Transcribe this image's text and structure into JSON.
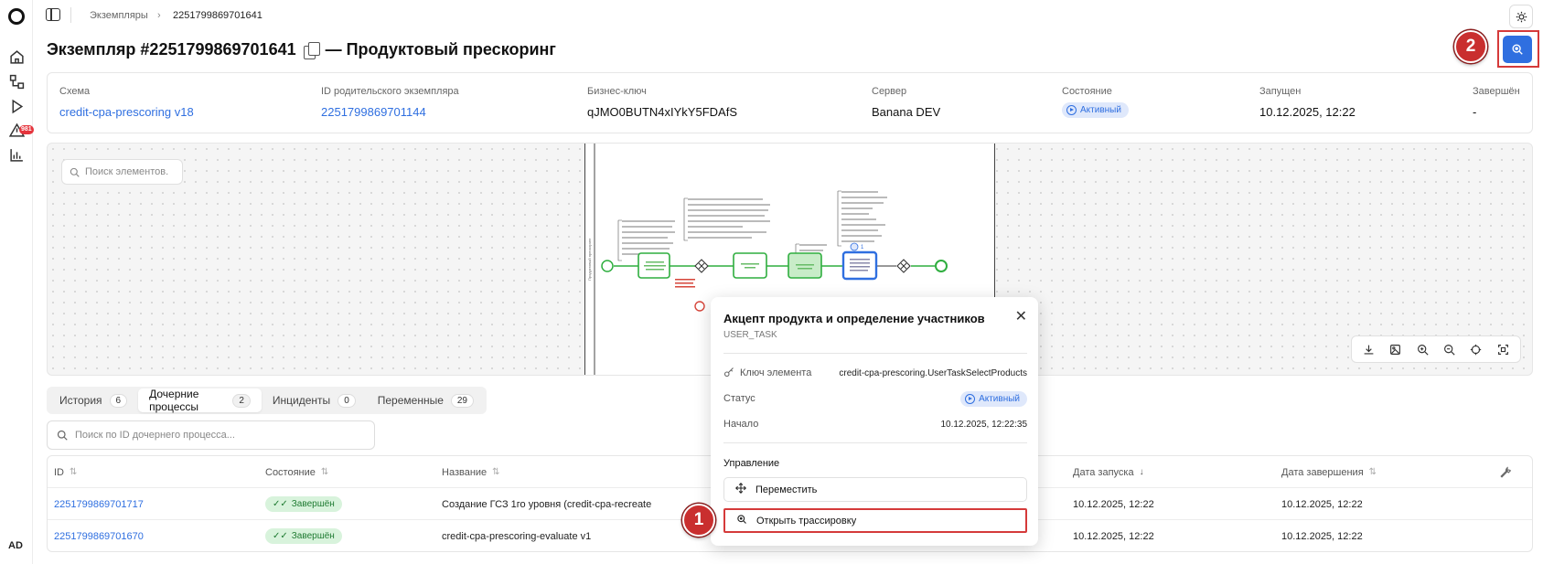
{
  "breadcrumb": {
    "parent": "Экземпляры",
    "current": "2251799869701641"
  },
  "header": {
    "title": "Экземпляр #2251799869701641",
    "subtitle": "— Продуктовый прескоринг"
  },
  "sidebar": {
    "alerts_badge": "981",
    "avatar": "AD"
  },
  "steps": {
    "one": "1",
    "two": "2"
  },
  "info": {
    "schema": {
      "label": "Схема",
      "value": "credit-cpa-prescoring v18"
    },
    "parent_id": {
      "label": "ID родительского экземпляра",
      "value": "2251799869701144"
    },
    "business_key": {
      "label": "Бизнес-ключ",
      "value": "qJMO0BUTN4xIYkY5FDAfS"
    },
    "server": {
      "label": "Сервер",
      "value": "Banana DEV"
    },
    "state": {
      "label": "Состояние",
      "value": "Активный"
    },
    "started": {
      "label": "Запущен",
      "value": "10.12.2025, 12:22"
    },
    "finished": {
      "label": "Завершён",
      "value": "-"
    }
  },
  "diagram": {
    "search_placeholder": "Поиск элементов.",
    "badge_count": "1",
    "pool_label": "Продуктовый прескоринг"
  },
  "tabs": [
    {
      "label": "История",
      "count": "6"
    },
    {
      "label": "Дочерние процессы",
      "count": "2"
    },
    {
      "label": "Инциденты",
      "count": "0"
    },
    {
      "label": "Переменные",
      "count": "29"
    }
  ],
  "child_search": {
    "placeholder": "Поиск по ID дочернего процесса..."
  },
  "table": {
    "columns": [
      "ID",
      "Состояние",
      "Название",
      "Дата запуска",
      "Дата завершения"
    ],
    "rows": [
      {
        "id": "2251799869701717",
        "state": "Завершён",
        "name": "Создание ГСЗ 1го уровня (credit-cpa-recreate",
        "start": "10.12.2025, 12:22",
        "end": "10.12.2025, 12:22"
      },
      {
        "id": "2251799869701670",
        "state": "Завершён",
        "name": "credit-cpa-prescoring-evaluate v1",
        "start": "10.12.2025, 12:22",
        "end": "10.12.2025, 12:22"
      }
    ]
  },
  "popover": {
    "title": "Акцепт продукта и определение участников",
    "type": "USER_TASK",
    "key_label": "Ключ элемента",
    "key_value": "credit-cpa-prescoring.UserTaskSelectProducts",
    "status_label": "Статус",
    "status_value": "Активный",
    "start_label": "Начало",
    "start_value": "10.12.2025, 12:22:35",
    "manage_label": "Управление",
    "move_label": "Переместить",
    "trace_label": "Открыть трассировку"
  },
  "colors": {
    "accent": "#2f6fe0",
    "highlight": "#d53a3a",
    "success": "#1e7a31"
  }
}
